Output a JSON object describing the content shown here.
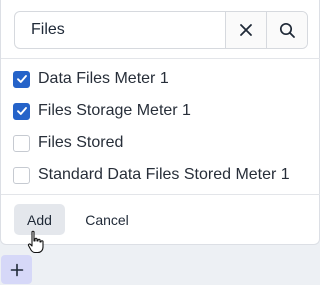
{
  "search": {
    "value": "Files",
    "clear_icon": "close-icon",
    "search_icon": "search-icon"
  },
  "options": [
    {
      "label": "Data Files Meter 1",
      "checked": true
    },
    {
      "label": "Files Storage Meter 1",
      "checked": true
    },
    {
      "label": "Files Stored",
      "checked": false
    },
    {
      "label": "Standard Data Files Stored Meter 1",
      "checked": false
    }
  ],
  "actions": {
    "add_label": "Add",
    "cancel_label": "Cancel"
  },
  "colors": {
    "accent": "#2563c9",
    "add_button_bg": "#e4e7ec",
    "plus_button_bg": "#d6d8f8"
  },
  "plus_button_icon": "plus-icon"
}
